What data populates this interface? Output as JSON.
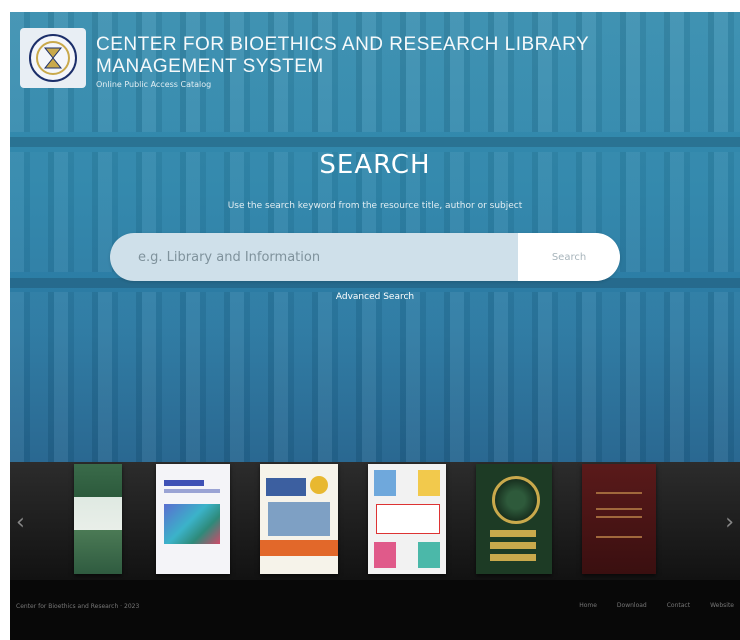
{
  "header": {
    "title": "CENTER FOR BIOETHICS AND RESEARCH LIBRARY MANAGEMENT SYSTEM",
    "subtitle": "Online Public Access Catalog"
  },
  "search": {
    "heading": "SEARCH",
    "hint": "Use the search keyword from the resource title, author or subject",
    "placeholder": "e.g. Library and Information",
    "button_label": "Search",
    "advanced_label": "Advanced Search"
  },
  "carousel": {
    "left_arrow": "‹",
    "right_arrow": "›"
  },
  "footer": {
    "copyright": "Center for Bioethics and Research · 2023",
    "nav": [
      "Home",
      "Download",
      "Contact",
      "Website"
    ]
  },
  "colors": {
    "hero": "#2f86ab",
    "search_box": "#cfe0ea",
    "footer": "#080808"
  }
}
